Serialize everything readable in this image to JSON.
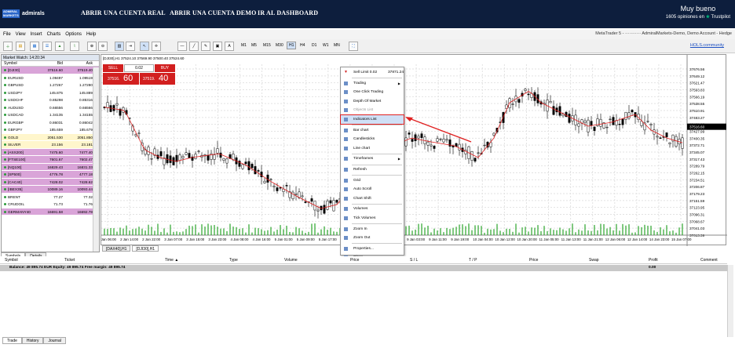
{
  "banner": {
    "logo_top": "ADMIRAL MARKETS",
    "logo_name": "admirals",
    "nav": [
      "ABRIR UNA CUENTA REAL",
      "ABRIR UNA CUENTA DEMO",
      "IR AL DASHBOARD"
    ],
    "rating_label": "Muy bueno",
    "reviews_text": "1605 opiniones en",
    "trustpilot": "Trustpilot"
  },
  "menu": [
    "File",
    "View",
    "Insert",
    "Charts",
    "Options",
    "Help"
  ],
  "title_info": "MetaTrader 5 - ··········· AdmiralMarkets-Demo, Demo Account - Hedge",
  "timeframes": [
    "M1",
    "M5",
    "M15",
    "M30",
    "H1",
    "H4",
    "D1",
    "W1",
    "MN"
  ],
  "hols": "HOLS.community",
  "market_watch": {
    "title": "Market Watch: 14:20:34",
    "cols": [
      "Symbol",
      "Bid",
      "Ask"
    ],
    "rows": [
      {
        "s": "[DJI30]",
        "b": "37516.60",
        "a": "37519.40",
        "bg": "#d9a4d8"
      },
      {
        "s": "EURUSD",
        "b": "1.09497",
        "a": "1.09519",
        "bg": "#fff"
      },
      {
        "s": "GBPUSD",
        "b": "1.27267",
        "a": "1.27280",
        "bg": "#fff"
      },
      {
        "s": "USDJPY",
        "b": "145.875",
        "a": "145.889",
        "bg": "#fff"
      },
      {
        "s": "USDCHF",
        "b": "0.85298",
        "a": "0.85316",
        "bg": "#fff"
      },
      {
        "s": "AUDUSD",
        "b": "0.66556",
        "a": "0.66566",
        "bg": "#fff"
      },
      {
        "s": "USDCAD",
        "b": "1.34135",
        "a": "1.34155",
        "bg": "#fff"
      },
      {
        "s": "EURGBP",
        "b": "0.86031",
        "a": "0.86042",
        "bg": "#fff"
      },
      {
        "s": "GBPJPY",
        "b": "185.659",
        "a": "185.679",
        "bg": "#fff"
      },
      {
        "s": "GOLD",
        "b": "2051.530",
        "a": "2051.850",
        "bg": "#fff6cc"
      },
      {
        "s": "SILVER",
        "b": "23.156",
        "a": "23.181",
        "bg": "#fff6cc"
      },
      {
        "s": "[ASX200]",
        "b": "7475.60",
        "a": "7477.40",
        "bg": "#d9a4d8"
      },
      {
        "s": "[FTSE100]",
        "b": "7601.67",
        "a": "7602.47",
        "bg": "#d9a4d8"
      },
      {
        "s": "[NQ100]",
        "b": "16829.43",
        "a": "16831.33",
        "bg": "#d9a4d8"
      },
      {
        "s": "[SP500]",
        "b": "4776.78",
        "a": "4777.18",
        "bg": "#d9a4d8"
      },
      {
        "s": "[CAC40]",
        "b": "7428.02",
        "a": "7428.62",
        "bg": "#d9a4d8"
      },
      {
        "s": "[IBEX35]",
        "b": "10089.16",
        "a": "10093.44",
        "bg": "#d9a4d8"
      },
      {
        "s": "BRENT",
        "b": "77.27",
        "a": "77.32",
        "bg": "#fff"
      },
      {
        "s": "CRUDOIL",
        "b": "71.73",
        "a": "71.76",
        "bg": "#fff"
      },
      {
        "s": "GERMANY40",
        "b": "16691.58",
        "a": "16692.78",
        "bg": "#d9a4d8"
      }
    ],
    "tabs": [
      "Symbols",
      "Details"
    ]
  },
  "chart": {
    "info": "[DJI30],H1 37524.10 37569.90 37500.40 37524.60",
    "sell": "SELL",
    "buy": "BUY",
    "lot": "0.02",
    "sell_price_small": "37516.",
    "sell_price_big": "60",
    "buy_price_small": "37519.",
    "buy_price_big": "40",
    "price_axis": [
      "37676.56",
      "37649.12",
      "37621.47",
      "37593.83",
      "37566.19",
      "37538.55",
      "37510.91",
      "37483.27",
      "37455.63",
      "37427.99",
      "37400.35",
      "37372.71",
      "37345.07",
      "37317.43",
      "37289.79",
      "37262.15",
      "37234.51",
      "37206.87",
      "37179.23",
      "37151.59",
      "37123.95",
      "37096.31",
      "37068.67",
      "37041.03",
      "37013.39"
    ],
    "current_price": "37516.60",
    "time_axis": [
      "2 Jan 06:00",
      "2 Jan 14:00",
      "2 Jan 22:00",
      "3 Jan 07:00",
      "3 Jan 15:00",
      "3 Jan 23:00",
      "4 Jan 08:00",
      "4 Jan 16:00",
      "5 Jan 01:00",
      "5 Jan 09:00",
      "5 Jan 17:00",
      "8 Jan 02:00",
      "8 Jan 10:00",
      "8 Jan 18:00",
      "9 Jan 03:00",
      "9 Jan 11:00",
      "9 Jan 19:00",
      "10 Jan 04:00",
      "10 Jan 12:00",
      "10 Jan 20:00",
      "11 Jan 05:00",
      "11 Jan 13:00",
      "11 Jan 21:00",
      "12 Jan 06:00",
      "12 Jan 14:00",
      "14 Jan 23:00",
      "15 Jan 07:00"
    ],
    "tabs": [
      "[DAX40],H1",
      "[DJI30],H1"
    ]
  },
  "context_menu": {
    "items": [
      {
        "label": "Sell Limit 0.02",
        "value": "37871.24",
        "icon": "down-arrow-icon",
        "sep_after": true
      },
      {
        "label": "Trading",
        "sub": true
      },
      {
        "label": "One Click Trading"
      },
      {
        "label": "Depth Of Market"
      },
      {
        "label": "Objects List",
        "disabled": true
      },
      {
        "label": "Indicators List",
        "highlight": true,
        "sep_after": true
      },
      {
        "label": "Bar chart"
      },
      {
        "label": "Candlesticks"
      },
      {
        "label": "Line chart",
        "sep_after": true
      },
      {
        "label": "Timeframes",
        "sub": true,
        "sep_after": true
      },
      {
        "label": "Refresh",
        "sep_after": true
      },
      {
        "label": "Grid"
      },
      {
        "label": "Auto Scroll"
      },
      {
        "label": "Chart Shift",
        "sep_after": true
      },
      {
        "label": "Volumes"
      },
      {
        "label": "Tick Volumes",
        "sep_after": true
      },
      {
        "label": "Zoom In"
      },
      {
        "label": "Zoom Out",
        "sep_after": true
      },
      {
        "label": "Properties..."
      },
      {
        "label": "Close"
      }
    ]
  },
  "terminal": {
    "cols": [
      "Symbol",
      "Ticket",
      "Time ▲",
      "Type",
      "Volume",
      "Price",
      "S / L",
      "T / P",
      "Price",
      "Swap",
      "Profit",
      "Comment"
    ],
    "balance": "Balance: 49 895.74 EUR  Equity: 49 895.74  Free margin: 49 895.74",
    "profit": "0.00",
    "tabs": [
      "Trade",
      "History",
      "Journal"
    ]
  },
  "colors": {
    "banner": "#0d1e3d",
    "ma": "#e02020",
    "candle": "#000000",
    "volume": "#2aa52a",
    "highlight": "#e02020"
  }
}
